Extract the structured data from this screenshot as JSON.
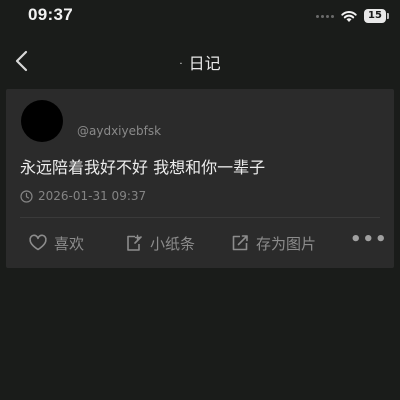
{
  "status": {
    "time": "09:37",
    "battery": "15"
  },
  "nav": {
    "dot": "·",
    "title": "日记"
  },
  "post": {
    "username": "@aydxiyebfsk",
    "content": "永远陪着我好不好 我想和你一辈子",
    "datetime": "2026-01-31 09:37"
  },
  "actions": {
    "like": "喜欢",
    "note": "小纸条",
    "save": "存为图片",
    "more": "•••"
  },
  "icons": {
    "back": "chevron-left-icon",
    "like": "heart-icon",
    "note": "sticky-note-icon",
    "save": "share-image-icon",
    "clock": "clock-icon",
    "wifi": "wifi-icon",
    "battery": "battery-icon"
  }
}
